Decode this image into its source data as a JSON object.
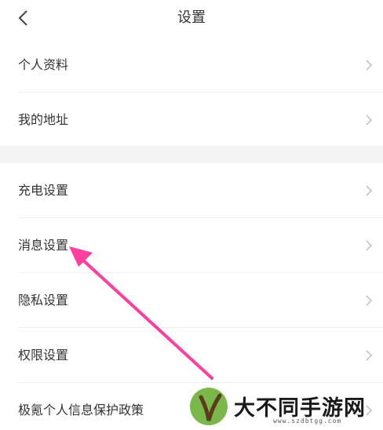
{
  "header": {
    "title": "设置",
    "back_icon": "chevron-left-icon"
  },
  "settings": {
    "group1": [
      {
        "label": "个人资料"
      },
      {
        "label": "我的地址"
      }
    ],
    "group2": [
      {
        "label": "充电设置"
      },
      {
        "label": "消息设置"
      },
      {
        "label": "隐私设置"
      },
      {
        "label": "权限设置"
      },
      {
        "label": "极氪个人信息保护政策"
      }
    ]
  },
  "annotation": {
    "arrow_color": "#ff3f9f",
    "points_to": "消息设置"
  },
  "watermark": {
    "text": "大不同手游网",
    "url": "www.szdbtgg.com",
    "logo_color": "#7bb84a"
  },
  "colors": {
    "text": "#333333",
    "chevron": "#bbbbbb",
    "divider": "#eeeeee",
    "section_gap": "#f4f4f4"
  }
}
